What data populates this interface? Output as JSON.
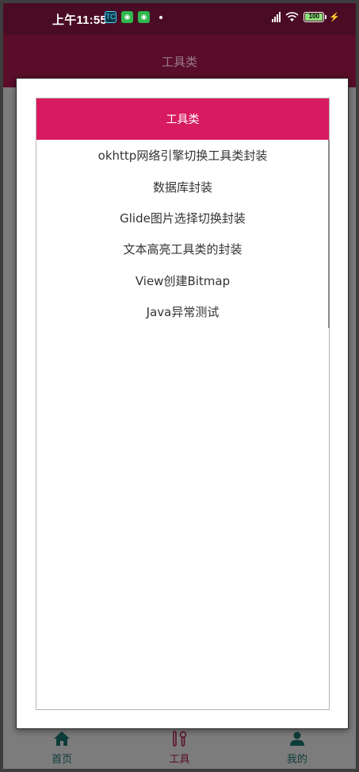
{
  "status_bar": {
    "time": "上午11:55",
    "app_icons": [
      "tc-icon",
      "wechat-icon",
      "wechat-icon"
    ],
    "battery_level": "100"
  },
  "app_bar": {
    "title": "工具类"
  },
  "dialog": {
    "title": "工具类",
    "items": [
      "okhttp网络引擎切换工具类封装",
      "数据库封装",
      "Glide图片选择切换封装",
      "文本高亮工具类的封装",
      "View创建Bitmap",
      "Java异常测试"
    ]
  },
  "bottom_nav": {
    "items": [
      {
        "label": "首页",
        "icon": "home-icon"
      },
      {
        "label": "工具",
        "icon": "tools-icon"
      },
      {
        "label": "我的",
        "icon": "person-icon"
      }
    ],
    "selected": "工具"
  },
  "colors": {
    "accent": "#d81b60",
    "primary_dark": "#4a0c24",
    "nav_active": "#5a0d29",
    "nav_inactive": "#0d3d3a"
  }
}
